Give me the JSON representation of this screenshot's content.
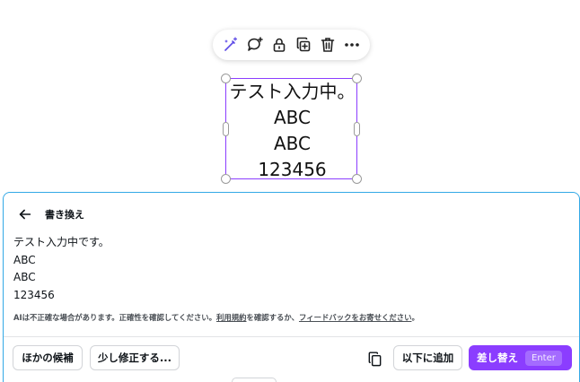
{
  "toolbar": {
    "icons": [
      "magic-edit-icon",
      "comment-add-icon",
      "lock-icon",
      "duplicate-icon",
      "trash-icon",
      "more-icon"
    ]
  },
  "canvas": {
    "lines": [
      "テスト入力中。",
      "ABC",
      "ABC",
      "123456"
    ]
  },
  "panel": {
    "title": "書き換え",
    "result_lines": [
      "テスト入力中です。",
      "ABC",
      "ABC",
      "123456"
    ],
    "disclaimer_prefix": "AIは不正確な場合があります。正確性を確認してください。",
    "terms_link": "利用規約",
    "disclaimer_middle": "を確認するか、",
    "feedback_link": "フィードバックをお寄せください",
    "disclaimer_suffix": "。",
    "buttons": {
      "alternatives": "ほかの候補",
      "tweak": "少し修正する...",
      "insert_below": "以下に追加",
      "replace": "差し替え",
      "replace_shortcut": "Enter"
    }
  },
  "colors": {
    "accent": "#8b3dff",
    "panel_border": "#33a9e6"
  }
}
